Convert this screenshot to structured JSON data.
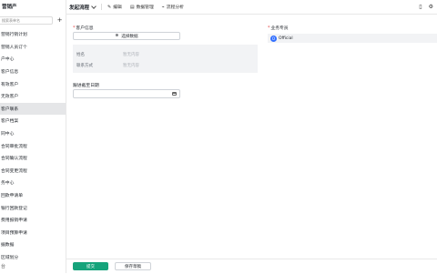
{
  "sidebar": {
    "header": "营销产",
    "search_placeholder": "搜索表单名",
    "add_label": "+",
    "items": [
      {
        "label": "营销行销计划"
      },
      {
        "label": "营销人员订个"
      },
      {
        "label": "户中心"
      },
      {
        "label": "客户信息"
      },
      {
        "label": "有效客户"
      },
      {
        "label": "无效客户"
      },
      {
        "label": "客户联系"
      },
      {
        "label": "客户档案"
      },
      {
        "label": "同中心"
      },
      {
        "label": "合同审批流程"
      },
      {
        "label": "合同确认流程"
      },
      {
        "label": "合同变更流程"
      },
      {
        "label": "务中心"
      },
      {
        "label": "回款申请单"
      },
      {
        "label": "银行回款登记"
      },
      {
        "label": "费用报销申请"
      },
      {
        "label": "项目预算申请"
      },
      {
        "label": "据数据"
      },
      {
        "label": "区域划分"
      }
    ],
    "active_index": 6,
    "footer": "台"
  },
  "topbar": {
    "title": "发起流程",
    "buttons": [
      {
        "icon": "edit-icon",
        "glyph": "✎",
        "label": "编辑"
      },
      {
        "icon": "data-manage-icon",
        "glyph": "▤",
        "label": "数据管理"
      },
      {
        "icon": "flow-analysis-icon",
        "glyph": "⌁",
        "label": "流程分析"
      }
    ],
    "right_icons": [
      "mobile-icon",
      "settings-icon"
    ]
  },
  "form": {
    "customer_info": {
      "label": "客户信息",
      "required_mark": "*",
      "select_button": "选择数据",
      "fields": [
        {
          "label": "姓名",
          "placeholder": "暂无内容"
        },
        {
          "label": "联系方式",
          "placeholder": "暂无内容"
        }
      ]
    },
    "deadline": {
      "label": "跟进截至日期"
    },
    "owner": {
      "label": "业务专员",
      "required_mark": "*",
      "avatar_text": "O",
      "name": "Official"
    }
  },
  "actions": {
    "submit": "提交",
    "save_draft": "保存草稿"
  },
  "colors": {
    "accent_green": "#16a37b",
    "avatar_blue": "#3370ff",
    "required_red": "#e54545"
  }
}
